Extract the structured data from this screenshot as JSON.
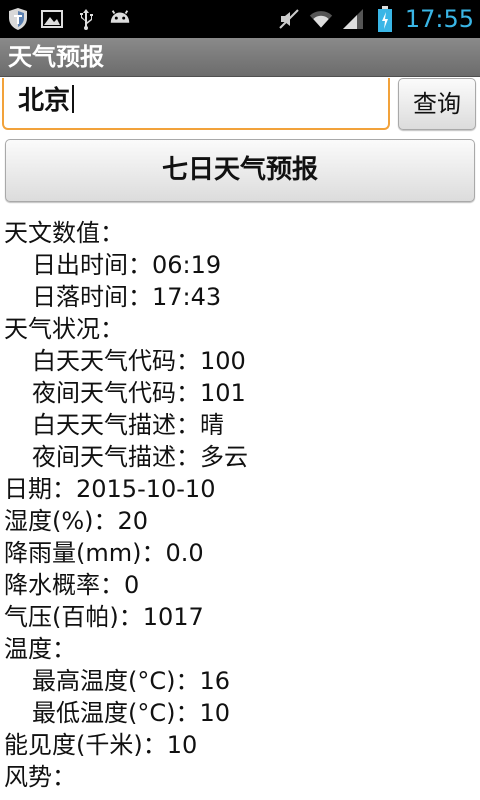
{
  "status_bar": {
    "time": "17:55",
    "left_icons": [
      "shield-icon",
      "image-icon",
      "usb-icon",
      "android-icon"
    ],
    "right_icons": [
      "mute-icon",
      "wifi-icon",
      "signal-icon",
      "battery-icon"
    ],
    "time_color": "#3ab6e6"
  },
  "app": {
    "title": "天气预报"
  },
  "search": {
    "value": "北京",
    "query_label": "查询",
    "accent_color": "#f2a23a"
  },
  "forecast_button_label": "七日天气预报",
  "info": {
    "astro_header": "天文数值：",
    "sunrise": "日出时间：06:19",
    "sunset": "日落时间：17:43",
    "cond_header": "天气状况：",
    "day_code": "白天天气代码：100",
    "night_code": "夜间天气代码：101",
    "day_desc": "白天天气描述：晴",
    "night_desc": "夜间天气描述：多云",
    "date": "日期：2015-10-10",
    "humidity": "湿度(%)：20",
    "precip": "降雨量(mm)：0.0",
    "pop": "降水概率：0",
    "pressure": "气压(百帕)：1017",
    "temp_header": "温度：",
    "temp_max": "最高温度(°C)：16",
    "temp_min": "最低温度(°C)：10",
    "visibility": "能见度(千米)：10",
    "wind_header": "风势："
  }
}
